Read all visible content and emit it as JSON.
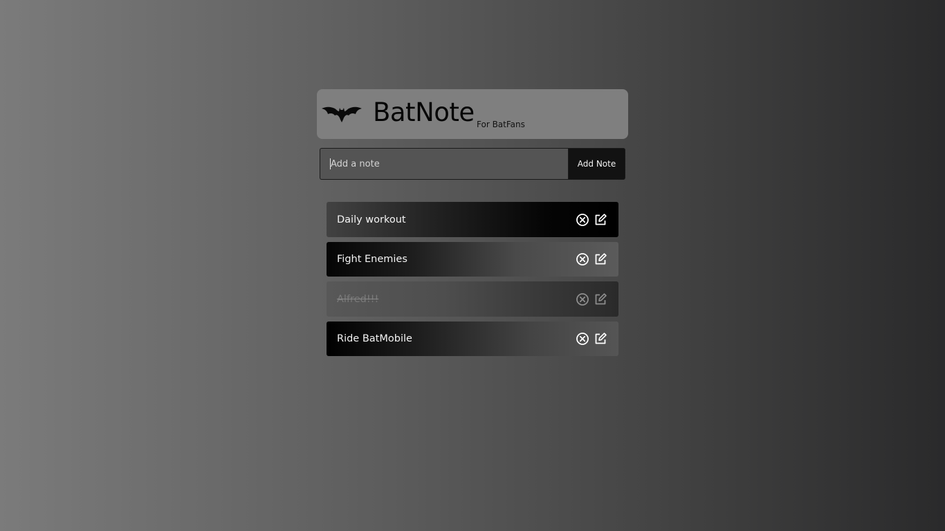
{
  "header": {
    "title": "BatNote",
    "subtitle": "For BatFans",
    "logo_icon": "bat-logo-icon"
  },
  "add_note": {
    "placeholder": "Add a note",
    "value": "",
    "button_label": "Add Note"
  },
  "notes": [
    {
      "text": "Daily workout",
      "completed": false,
      "actions": [
        "delete-icon",
        "edit-icon"
      ]
    },
    {
      "text": "Fight Enemies",
      "completed": false,
      "actions": [
        "delete-icon",
        "edit-icon"
      ]
    },
    {
      "text": "Alfred!!!",
      "completed": true,
      "actions": [
        "delete-icon",
        "edit-icon"
      ]
    },
    {
      "text": "Ride BatMobile",
      "completed": false,
      "actions": [
        "delete-icon",
        "edit-icon"
      ]
    }
  ],
  "colors": {
    "header_bg": "#7f7f7f",
    "input_bg": "#545454",
    "button_bg": "#121212",
    "note_text": "#f3f3f3",
    "completed_text": "#7a7a7a"
  }
}
